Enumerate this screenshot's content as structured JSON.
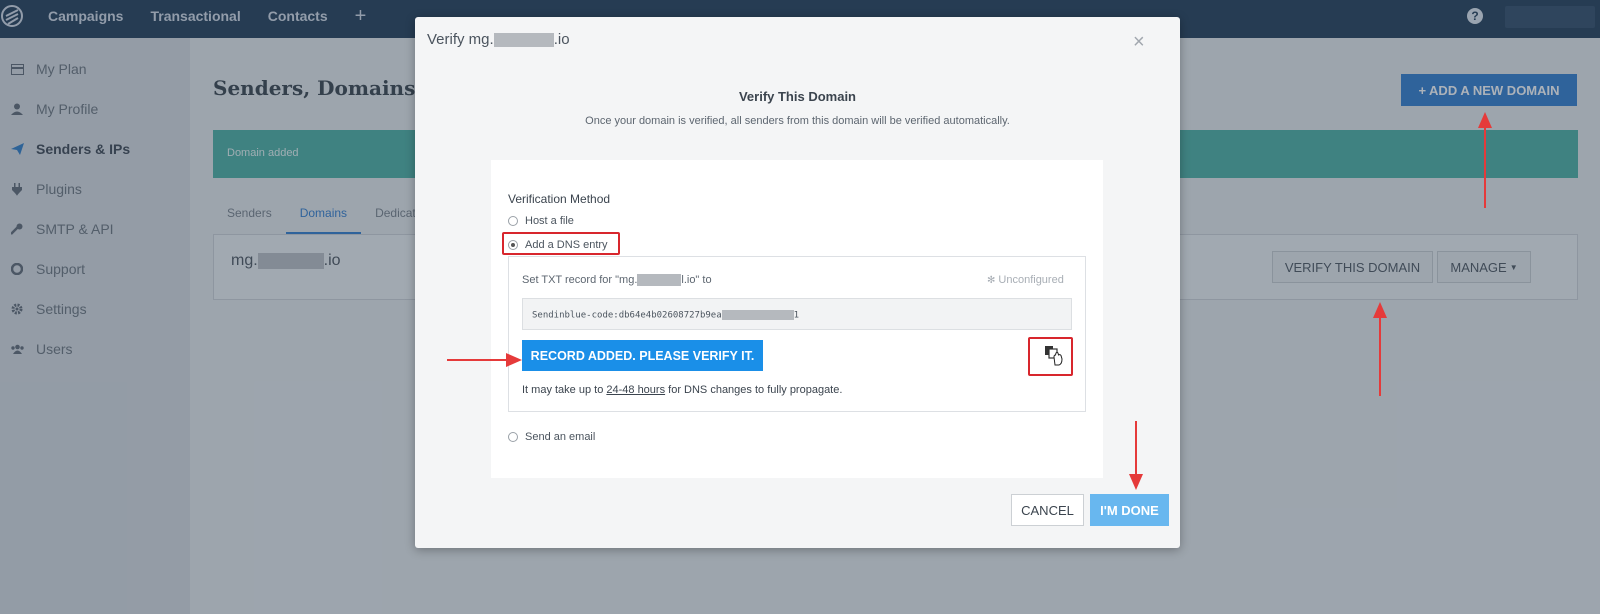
{
  "topnav": {
    "items": [
      "Campaigns",
      "Transactional",
      "Contacts"
    ],
    "add_symbol": "+",
    "help_symbol": "?"
  },
  "sidebar": {
    "items": [
      {
        "label": "My Plan",
        "icon": "card-icon"
      },
      {
        "label": "My Profile",
        "icon": "user-icon"
      },
      {
        "label": "Senders & IPs",
        "icon": "send-icon",
        "active": true
      },
      {
        "label": "Plugins",
        "icon": "plug-icon"
      },
      {
        "label": "SMTP & API",
        "icon": "wrench-icon"
      },
      {
        "label": "Support",
        "icon": "lifebuoy-icon"
      },
      {
        "label": "Settings",
        "icon": "gear-icon"
      },
      {
        "label": "Users",
        "icon": "users-icon"
      }
    ]
  },
  "main": {
    "title": "Senders, Domains & D",
    "add_domain_label": "ADD A NEW DOMAIN",
    "banner": "Domain added",
    "tabs": [
      "Senders",
      "Domains",
      "Dedicate"
    ],
    "active_tab": "Domains",
    "domain": {
      "prefix": "mg.",
      "suffix": ".io"
    },
    "verify_label": "VERIFY THIS DOMAIN",
    "manage_label": "MANAGE"
  },
  "modal": {
    "title_prefix": "Verify mg.",
    "title_suffix": ".io",
    "close": "×",
    "heading": "Verify This Domain",
    "subheading": "Once your domain is verified, all senders from this domain will be verified automatically.",
    "method_label": "Verification Method",
    "options": [
      "Host a file",
      "Add a DNS entry",
      "Send an email"
    ],
    "selected_option": "Add a DNS entry",
    "txt_label_prefix": "Set TXT record for \"mg.",
    "txt_label_suffix": "l.io\" to",
    "status": "Unconfigured",
    "code_prefix": "Sendinblue-code:db64e4b02608727b9ea",
    "code_suffix": "1",
    "record_button": "RECORD ADDED. PLEASE VERIFY IT.",
    "propagate_prefix": "It may take up to ",
    "propagate_link": "24-48 hours",
    "propagate_suffix": " for DNS changes to fully propagate.",
    "cancel": "CANCEL",
    "done": "I'M DONE"
  },
  "colors": {
    "topbar": "#0b2946",
    "primary": "#1d6fc9",
    "banner": "#3aa89a",
    "annotation": "#d8262d"
  }
}
